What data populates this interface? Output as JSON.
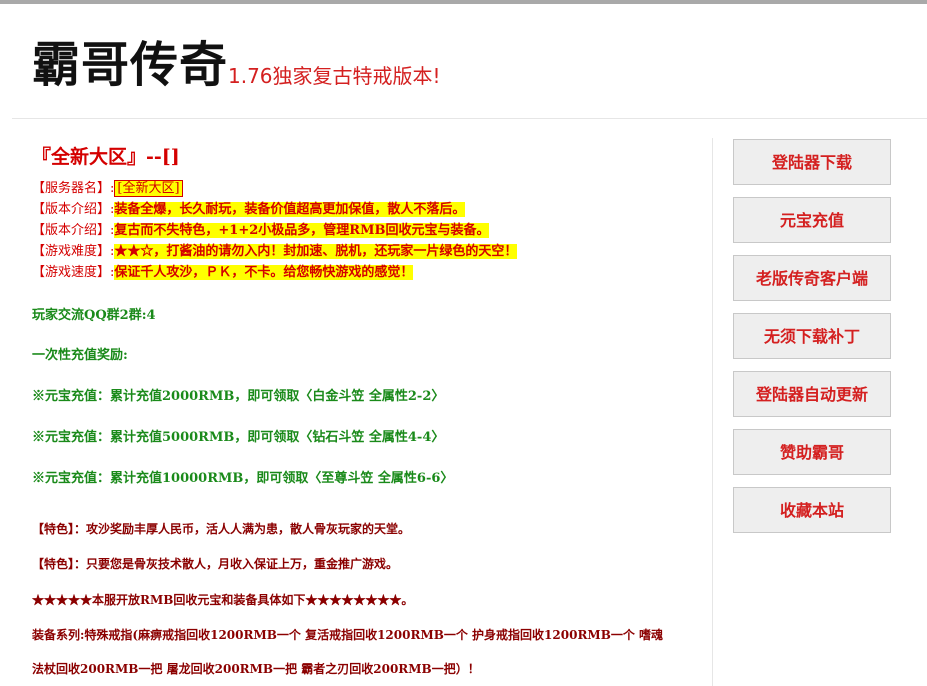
{
  "header": {
    "site_title": "霸哥传奇",
    "subtitle": "1.76独家复古特戒版本!"
  },
  "main": {
    "zone_title": "『全新大区』--[]",
    "info_rows": [
      {
        "label": "【服务器名】:",
        "value": "[全新大区]"
      },
      {
        "label": "【版本介绍】:",
        "value": "装备全爆，长久耐玩，装备价值超高更加保值，散人不落后。"
      },
      {
        "label": "【版本介绍】:",
        "value": "复古而不失特色，+1+2小极品多，管理RMB回收元宝与装备。"
      },
      {
        "label": "【游戏难度】:",
        "value": "★★☆，打酱油的请勿入内！封加速、脱机，还玩家一片绿色的天空！"
      },
      {
        "label": "【游戏速度】:",
        "value": "保证千人攻沙，ＰＫ，不卡。给您畅快游戏的感觉！"
      }
    ],
    "qq_group": "玩家交流QQ群2群:4",
    "recharge_title": "一次性充值奖励:",
    "rewards": [
      "※元宝充值：累计充值2000RMB，即可领取〈白金斗笠 全属性2-2〉",
      "※元宝充值：累计充值5000RMB，即可领取〈钻石斗笠 全属性4-4〉",
      "※元宝充值：累计充值10000RMB，即可领取〈至尊斗笠 全属性6-6〉"
    ],
    "features": [
      "【特色】：攻沙奖励丰厚人民币，活人人满为患，散人骨灰玩家的天堂。",
      "【特色】：只要您是骨灰技术散人，月收入保证上万，重金推广游戏。"
    ],
    "rmb_note": "★★★★★本服开放RMB回收元宝和装备具体如下★★★★★★★★。",
    "equip_line1": "装备系列:特殊戒指(麻痹戒指回收1200RMB一个 复活戒指回收1200RMB一个 护身戒指回收1200RMB一个 嗜魂",
    "equip_line2": "法杖回收200RMB一把 屠龙回收200RMB一把 霸者之刃回收200RMB一把）！"
  },
  "sidebar": {
    "buttons": [
      {
        "label": "登陆器下载"
      },
      {
        "label": "元宝充值"
      },
      {
        "label": "老版传奇客户端"
      },
      {
        "label": "无须下载补丁"
      },
      {
        "label": "登陆器自动更新"
      },
      {
        "label": "赞助霸哥"
      },
      {
        "label": "收藏本站"
      }
    ]
  },
  "colors": {
    "accent_red": "#d42020",
    "highlight_yellow": "#ffff00",
    "green_text": "#1a8a1a",
    "dark_red_text": "#8b0000",
    "button_bg": "#eeeeee"
  }
}
